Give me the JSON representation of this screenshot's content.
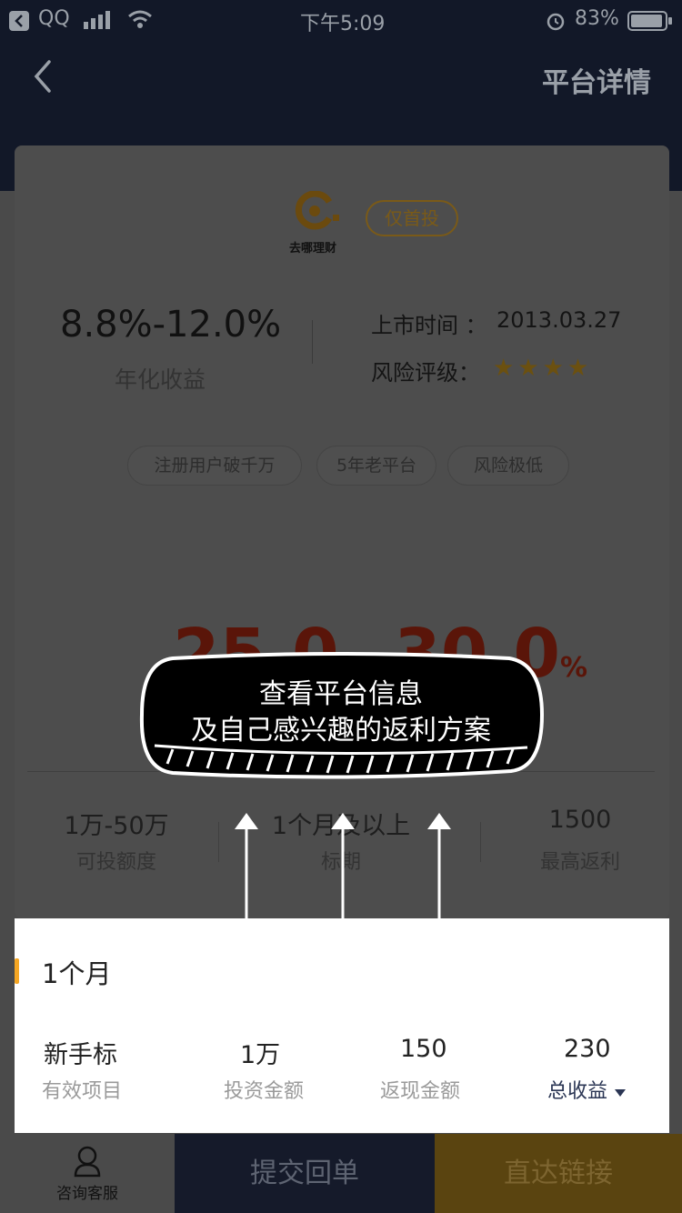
{
  "status_bar": {
    "carrier": "QQ",
    "time": "下午5:09",
    "battery": "83%"
  },
  "nav": {
    "title": "平台详情"
  },
  "platform": {
    "logo_text": "去哪理财",
    "badge": "仅首投",
    "annual_rate": "8.8%-12.0%",
    "annual_rate_label": "年化收益",
    "listing_label": "上市时间 ：",
    "listing_date": "2013.03.27",
    "risk_label": "风险评级：",
    "risk_stars": "★★★★",
    "risk_rating": 3.5,
    "tags": [
      "注册用户破千万",
      "5年老平台",
      "风险极低"
    ]
  },
  "promo": {
    "rate_low": "25.0",
    "rate_high": "30.0",
    "unit": "%",
    "dash": "-"
  },
  "stats": [
    {
      "value": "1万-50万",
      "label": "可投额度"
    },
    {
      "value": "1个月及以上",
      "label": "标期"
    },
    {
      "value": "1500",
      "label": "最高返利"
    }
  ],
  "overlay": {
    "line1": "查看平台信息",
    "line2": "及自己感兴趣的返利方案"
  },
  "plan": {
    "period": "1个月",
    "columns": [
      {
        "value": "新手标",
        "label": "有效项目"
      },
      {
        "value": "1万",
        "label": "投资金额"
      },
      {
        "value": "150",
        "label": "返现金额"
      },
      {
        "value": "230",
        "label": "总收益"
      }
    ]
  },
  "bottom_bar": {
    "consult": "咨询客服",
    "submit": "提交回单",
    "direct": "直达链接"
  },
  "colors": {
    "accent": "#f5a623",
    "nav_dark": "#121828",
    "promo_red": "#5a1509"
  }
}
